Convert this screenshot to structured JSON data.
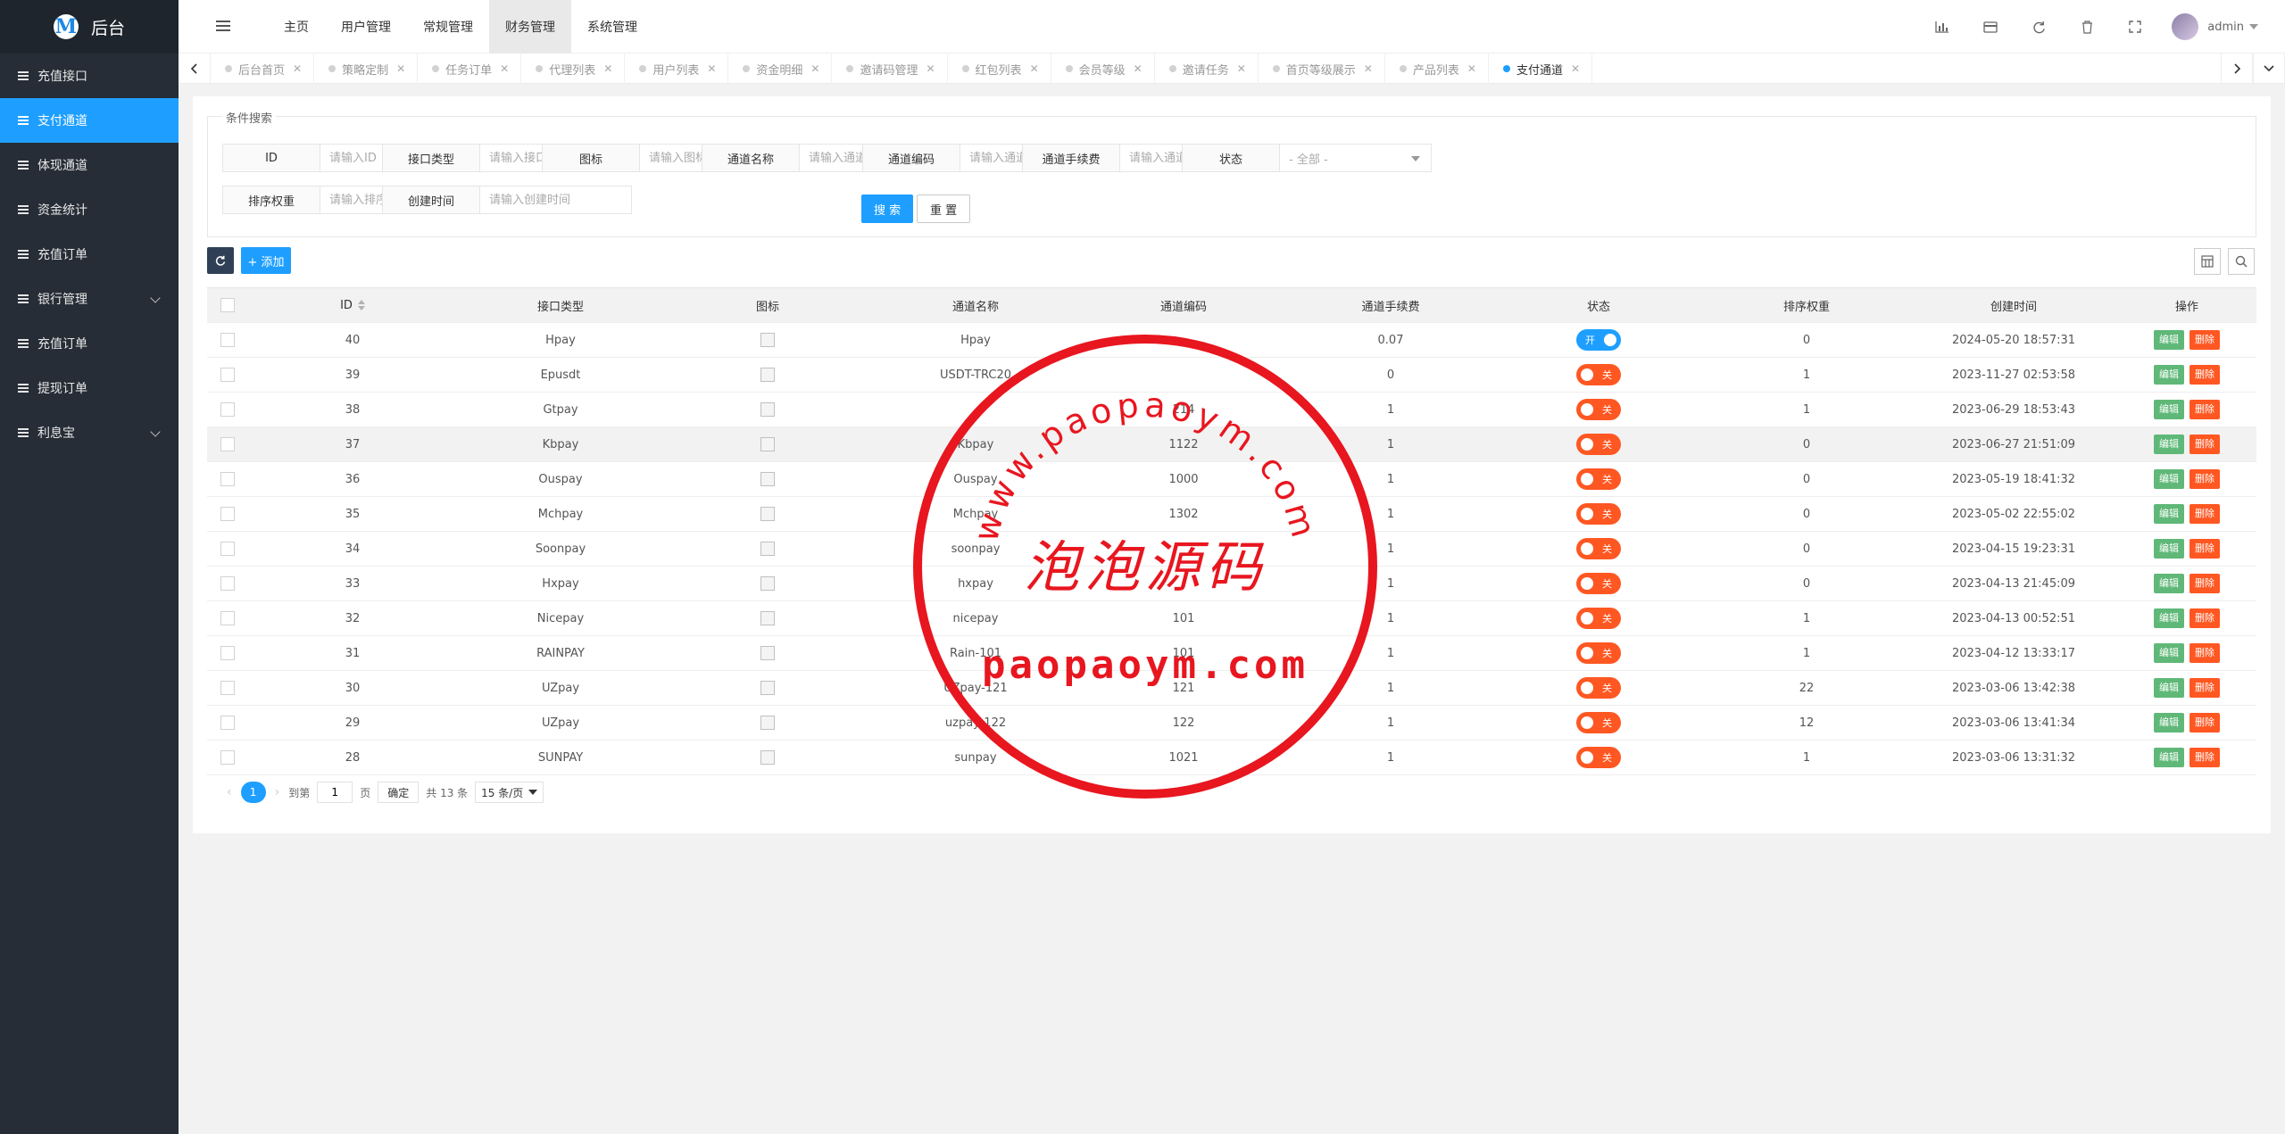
{
  "app": {
    "title": "后台",
    "logo_letter": "M"
  },
  "sidebar": {
    "items": [
      {
        "label": "充值接口",
        "active": false,
        "expandable": false
      },
      {
        "label": "支付通道",
        "active": true,
        "expandable": false
      },
      {
        "label": "体现通道",
        "active": false,
        "expandable": false
      },
      {
        "label": "资金统计",
        "active": false,
        "expandable": false
      },
      {
        "label": "充值订单",
        "active": false,
        "expandable": false
      },
      {
        "label": "银行管理",
        "active": false,
        "expandable": true
      },
      {
        "label": "充值订单",
        "active": false,
        "expandable": false
      },
      {
        "label": "提现订单",
        "active": false,
        "expandable": false
      },
      {
        "label": "利息宝",
        "active": false,
        "expandable": true
      }
    ]
  },
  "header": {
    "nav": [
      {
        "label": "主页",
        "active": false
      },
      {
        "label": "用户管理",
        "active": false
      },
      {
        "label": "常规管理",
        "active": false
      },
      {
        "label": "财务管理",
        "active": true
      },
      {
        "label": "系统管理",
        "active": false
      }
    ],
    "icons": [
      "chart-icon",
      "card-icon",
      "refresh-icon",
      "trash-icon",
      "fullscreen-icon"
    ],
    "user": "admin"
  },
  "tabs": [
    {
      "label": "后台首页",
      "active": false
    },
    {
      "label": "策略定制",
      "active": false
    },
    {
      "label": "任务订单",
      "active": false
    },
    {
      "label": "代理列表",
      "active": false
    },
    {
      "label": "用户列表",
      "active": false
    },
    {
      "label": "资金明细",
      "active": false
    },
    {
      "label": "邀请码管理",
      "active": false
    },
    {
      "label": "红包列表",
      "active": false
    },
    {
      "label": "会员等级",
      "active": false
    },
    {
      "label": "邀请任务",
      "active": false
    },
    {
      "label": "首页等级展示",
      "active": false
    },
    {
      "label": "产品列表",
      "active": false
    },
    {
      "label": "支付通道",
      "active": true
    }
  ],
  "search": {
    "legend": "条件搜索",
    "fields": [
      {
        "label": "ID",
        "placeholder": "请输入ID"
      },
      {
        "label": "接口类型",
        "placeholder": "请输入接口类型"
      },
      {
        "label": "图标",
        "placeholder": "请输入图标"
      },
      {
        "label": "通道名称",
        "placeholder": "请输入通道名称"
      },
      {
        "label": "通道编码",
        "placeholder": "请输入通道编码"
      },
      {
        "label": "通道手续费",
        "placeholder": "请输入通道手续费"
      },
      {
        "label": "状态",
        "select_value": "- 全部 -"
      },
      {
        "label": "排序权重",
        "placeholder": "请输入排序权重"
      },
      {
        "label": "创建时间",
        "placeholder": "请输入创建时间"
      }
    ],
    "search_label": "搜 索",
    "reset_label": "重 置"
  },
  "toolbar": {
    "add_label": "+ 添加"
  },
  "table": {
    "columns": [
      "ID",
      "接口类型",
      "图标",
      "通道名称",
      "通道编码",
      "通道手续费",
      "状态",
      "排序权重",
      "创建时间",
      "操作"
    ],
    "edit_label": "编辑",
    "delete_label": "删除",
    "on_label": "开",
    "off_label": "关",
    "rows": [
      {
        "id": "40",
        "type": "Hpay",
        "name": "Hpay",
        "code": "",
        "fee": "0.07",
        "status": true,
        "weight": "0",
        "created": "2024-05-20 18:57:31"
      },
      {
        "id": "39",
        "type": "Epusdt",
        "name": "USDT-TRC20",
        "code": "",
        "fee": "0",
        "status": false,
        "weight": "1",
        "created": "2023-11-27 02:53:58"
      },
      {
        "id": "38",
        "type": "Gtpay",
        "name": "",
        "code": "214",
        "fee": "1",
        "status": false,
        "weight": "1",
        "created": "2023-06-29 18:53:43"
      },
      {
        "id": "37",
        "type": "Kbpay",
        "name": "Kbpay",
        "code": "1122",
        "fee": "1",
        "status": false,
        "weight": "0",
        "created": "2023-06-27 21:51:09"
      },
      {
        "id": "36",
        "type": "Ouspay",
        "name": "Ouspay",
        "code": "1000",
        "fee": "1",
        "status": false,
        "weight": "0",
        "created": "2023-05-19 18:41:32"
      },
      {
        "id": "35",
        "type": "Mchpay",
        "name": "Mchpay",
        "code": "1302",
        "fee": "1",
        "status": false,
        "weight": "0",
        "created": "2023-05-02 22:55:02"
      },
      {
        "id": "34",
        "type": "Soonpay",
        "name": "soonpay",
        "code": "",
        "fee": "1",
        "status": false,
        "weight": "0",
        "created": "2023-04-15 19:23:31"
      },
      {
        "id": "33",
        "type": "Hxpay",
        "name": "hxpay",
        "code": "",
        "fee": "1",
        "status": false,
        "weight": "0",
        "created": "2023-04-13 21:45:09"
      },
      {
        "id": "32",
        "type": "Nicepay",
        "name": "nicepay",
        "code": "101",
        "fee": "1",
        "status": false,
        "weight": "1",
        "created": "2023-04-13 00:52:51"
      },
      {
        "id": "31",
        "type": "RAINPAY",
        "name": "Rain-101",
        "code": "101",
        "fee": "1",
        "status": false,
        "weight": "1",
        "created": "2023-04-12 13:33:17"
      },
      {
        "id": "30",
        "type": "UZpay",
        "name": "UZpay-121",
        "code": "121",
        "fee": "1",
        "status": false,
        "weight": "22",
        "created": "2023-03-06 13:42:38"
      },
      {
        "id": "29",
        "type": "UZpay",
        "name": "uzpay-122",
        "code": "122",
        "fee": "1",
        "status": false,
        "weight": "12",
        "created": "2023-03-06 13:41:34"
      },
      {
        "id": "28",
        "type": "SUNPAY",
        "name": "sunpay",
        "code": "1021",
        "fee": "1",
        "status": false,
        "weight": "1",
        "created": "2023-03-06 13:31:32"
      }
    ]
  },
  "pager": {
    "current": "1",
    "goto_prefix": "到第",
    "goto_value": "1",
    "goto_suffix": "页",
    "confirm": "确定",
    "total": "共 13 条",
    "size": "15 条/页"
  },
  "watermark": {
    "arc_text": "www.paopaoym.com",
    "center_text": "泡泡源码",
    "bottom_text": "paopaoym.com",
    "color": "#e8161f"
  }
}
